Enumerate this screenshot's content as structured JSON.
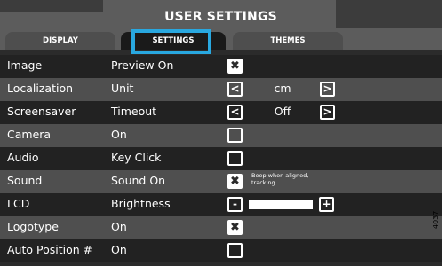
{
  "header": {
    "title": "USER SETTINGS"
  },
  "tabs": [
    {
      "label": "DISPLAY"
    },
    {
      "label": "SETTINGS",
      "selected": true
    },
    {
      "label": "THEMES"
    }
  ],
  "rows": {
    "image": {
      "name": "Image",
      "value": "Preview On",
      "checked": true
    },
    "localization": {
      "name": "Localization",
      "value": "Unit",
      "option": "cm",
      "left": "<",
      "right": ">"
    },
    "screensaver": {
      "name": "Screensaver",
      "value": "Timeout",
      "option": "Off",
      "left": "<",
      "right": ">"
    },
    "camera": {
      "name": "Camera",
      "value": "On",
      "checked": false
    },
    "audio": {
      "name": "Audio",
      "value": "Key Click",
      "checked": false
    },
    "sound": {
      "name": "Sound",
      "value": "Sound On",
      "checked": true,
      "note": "Beep when aligned, tracking."
    },
    "lcd": {
      "name": "LCD",
      "value": "Brightness",
      "minus": "-",
      "plus": "+",
      "level": 1.0
    },
    "logotype": {
      "name": "Logotype",
      "value": "On",
      "checked": true
    },
    "autoposition": {
      "name": "Auto Position #",
      "value": "On",
      "checked": false
    }
  },
  "figure_id": "4037",
  "colors": {
    "accent": "#29a8e0",
    "header": "#5c5c5c",
    "row_dark": "#222222",
    "row_light": "#4f4f4f"
  }
}
